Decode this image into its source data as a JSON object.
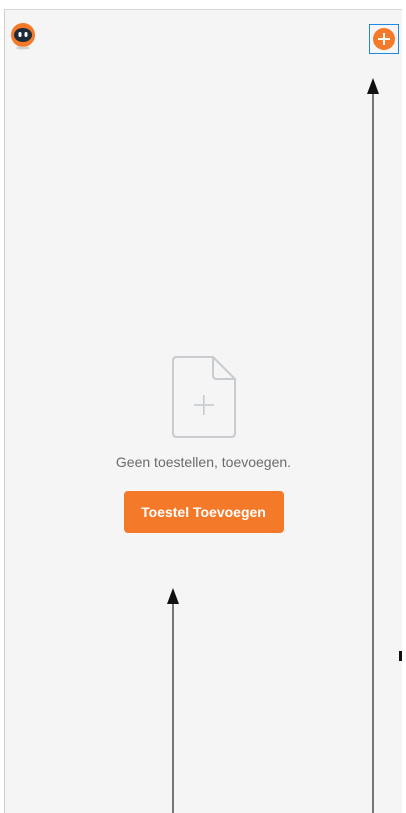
{
  "header": {
    "avatar_icon": "robot-avatar-icon",
    "add_icon": "plus-circle-icon"
  },
  "empty_state": {
    "icon": "add-file-icon",
    "message": "Geen toestellen, toevoegen.",
    "button_label": "Toestel Toevoegen"
  },
  "colors": {
    "accent": "#f47a2a",
    "background": "#f5f5f5",
    "highlight": "#1e88e5"
  }
}
